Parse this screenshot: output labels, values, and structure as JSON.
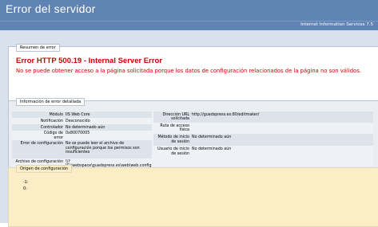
{
  "header": {
    "title": "Error del servidor",
    "product": "Internet Information Services 7.5"
  },
  "summary": {
    "legend": "Resumen de error",
    "error_title": "Error HTTP 500.19 - Internal Server Error",
    "error_description": "No se puede obtener acceso a la página solicitada porque los datos de configuración relacionados de la página no son válidos."
  },
  "details": {
    "legend": "Información de error detallada",
    "left": [
      {
        "label": "Módulo",
        "value": "IIS Web Core"
      },
      {
        "label": "Notificación",
        "value": "Desconocido"
      },
      {
        "label": "Controlador",
        "value": "No determinado aún"
      },
      {
        "label": "Código de error",
        "value": "0x80070005"
      },
      {
        "label": "Error de configuración",
        "value": "No se puede leer el archivo de configuración porque los permisos son insuficientes"
      },
      {
        "label": "Archivo de configuración",
        "value": "\\\\?\\C:\\webspace\\guadspress.es\\web\\web.config"
      }
    ],
    "right": [
      {
        "label": "Dirección URL solicitada",
        "value": "http://guadspress.es:80/editmaker/"
      },
      {
        "label": "Ruta de acceso física",
        "value": ""
      },
      {
        "label": "Método de inicio de sesión",
        "value": "No determinado aún"
      },
      {
        "label": "Usuario de inicio de sesión",
        "value": "No determinado aún"
      }
    ]
  },
  "config": {
    "legend": "Origen de configuración",
    "lines": [
      "-1:",
      "0:"
    ]
  }
}
